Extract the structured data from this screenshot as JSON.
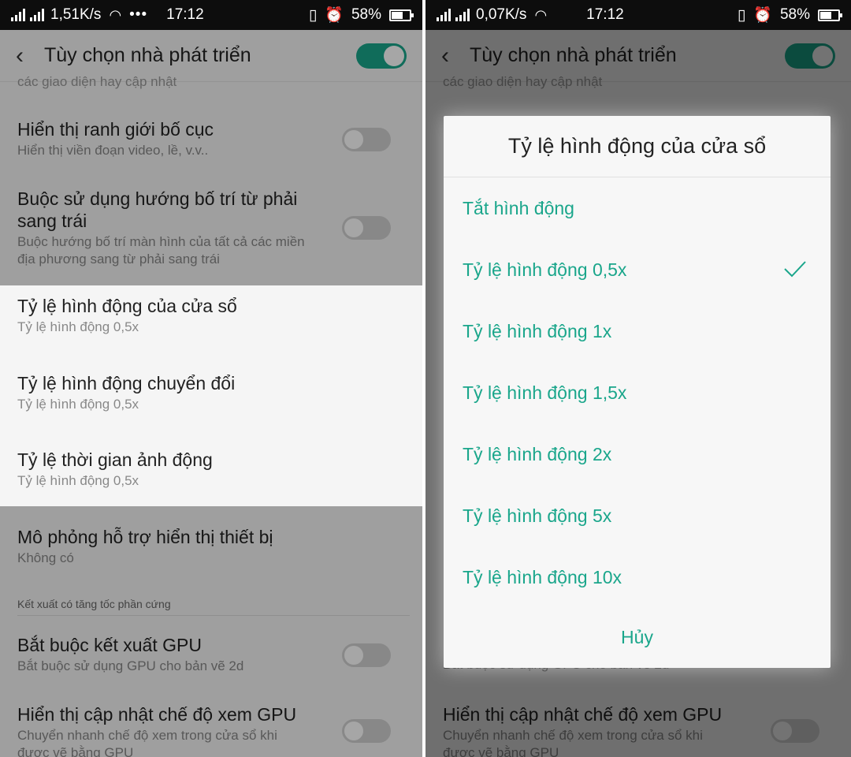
{
  "statusbar_left": {
    "speed": "1,51K/s",
    "time": "17:12",
    "battery": "58%",
    "battery_level": 0.58
  },
  "statusbar_right": {
    "speed": "0,07K/s",
    "time": "17:12",
    "battery": "58%",
    "battery_level": 0.58
  },
  "appbar": {
    "title": "Tùy chọn nhà phát triển"
  },
  "cut_text": "các giao diện hay cập nhật",
  "items": {
    "layout_bounds": {
      "title": "Hiển thị ranh giới bố cục",
      "subtitle": "Hiển thị viền đoạn video, lề, v.v.."
    },
    "rtl": {
      "title_line1": "Buộc sử dụng hướng bố trí từ phải",
      "title_line2": "sang trái",
      "subtitle_line1": "Buộc hướng bố trí màn hình của tất cả các miền",
      "subtitle_line2": "địa phương sang từ phải sang trái"
    },
    "window_scale": {
      "title": "Tỷ lệ hình động của cửa sổ",
      "subtitle": "Tỷ lệ hình động 0,5x"
    },
    "transition_scale": {
      "title": "Tỷ lệ hình động chuyển đổi",
      "subtitle": "Tỷ lệ hình động 0,5x"
    },
    "duration_scale": {
      "title": "Tỷ lệ thời gian ảnh động",
      "subtitle": "Tỷ lệ hình động 0,5x"
    },
    "secondary_display": {
      "title": "Mô phỏng hỗ trợ hiển thị thiết bị",
      "subtitle": "Không có"
    },
    "section_hw": "Kết xuất có tăng tốc phần cứng",
    "force_gpu": {
      "title": "Bắt buộc kết xuất GPU",
      "subtitle": "Bắt buộc sử dụng GPU cho bản vẽ 2d"
    },
    "gpu_view_updates": {
      "title": "Hiển thị cập nhật chế độ xem GPU",
      "subtitle_line1": "Chuyển nhanh chế độ xem trong cửa sổ khi",
      "subtitle_line2": "được vẽ bằng GPU"
    }
  },
  "dialog": {
    "title": "Tỷ lệ hình động của cửa sổ",
    "options": [
      "Tắt hình động",
      "Tỷ lệ hình động 0,5x",
      "Tỷ lệ hình động 1x",
      "Tỷ lệ hình động 1,5x",
      "Tỷ lệ hình động 2x",
      "Tỷ lệ hình động 5x",
      "Tỷ lệ hình động 10x"
    ],
    "selected_index": 1,
    "cancel": "Hủy"
  },
  "colors": {
    "accent": "#1aa68b",
    "toggle_off": "#d2d2d2",
    "statusbar": "#0d0d0d"
  }
}
